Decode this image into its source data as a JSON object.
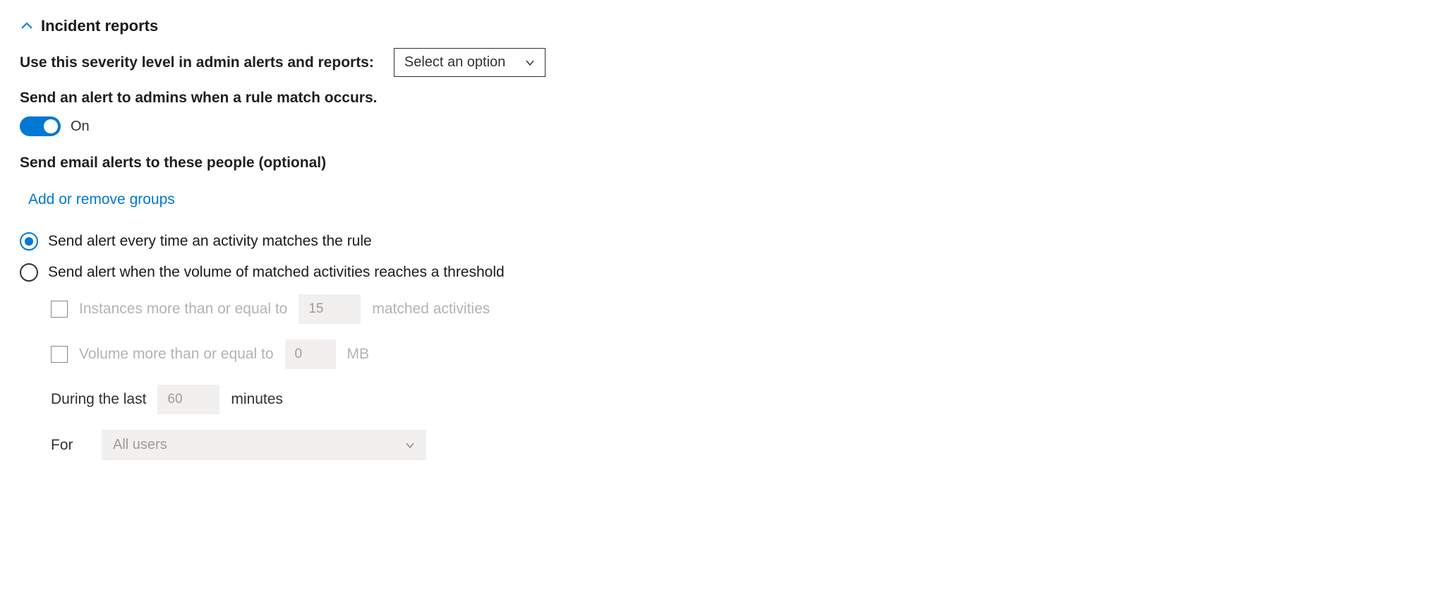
{
  "section": {
    "title": "Incident reports"
  },
  "severity": {
    "label": "Use this severity level in admin alerts and reports:",
    "placeholder": "Select an option"
  },
  "alertToggle": {
    "label": "Send an alert to admins when a rule match occurs.",
    "state": "On"
  },
  "emailAlerts": {
    "label": "Send email alerts to these people (optional)",
    "link": "Add or remove groups"
  },
  "radios": {
    "everyTime": "Send alert every time an activity matches the rule",
    "threshold": "Send alert when the volume of matched activities reaches a threshold"
  },
  "threshold": {
    "instancesLabel": "Instances more than or equal to",
    "instancesValue": "15",
    "matchedSuffix": "matched activities",
    "volumeLabel": "Volume more than or equal to",
    "volumeValue": "0",
    "volumeUnit": "MB",
    "duringLabel": "During the last",
    "duringValue": "60",
    "duringUnit": "minutes",
    "forLabel": "For",
    "forValue": "All users"
  }
}
